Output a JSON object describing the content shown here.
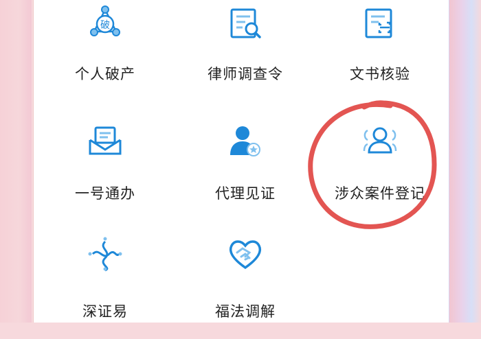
{
  "services": [
    {
      "label": "个人破产",
      "icon": "bankruptcy-icon",
      "badge_char": "破"
    },
    {
      "label": "律师调查令",
      "icon": "investigation-order-icon"
    },
    {
      "label": "文书核验",
      "icon": "document-verify-icon"
    },
    {
      "label": "一号通办",
      "icon": "one-stop-inbox-icon"
    },
    {
      "label": "代理见证",
      "icon": "agent-witness-icon"
    },
    {
      "label": "涉众案件登记",
      "icon": "mass-case-registration-icon"
    },
    {
      "label": "深证易",
      "icon": "shenzhengyi-icon"
    },
    {
      "label": "福法调解",
      "icon": "mediation-heart-icon"
    }
  ],
  "colors": {
    "icon_blue": "#1e88d8",
    "icon_light": "#7fc0ee",
    "annotation_red": "#e0433f",
    "label_text": "#222222"
  }
}
